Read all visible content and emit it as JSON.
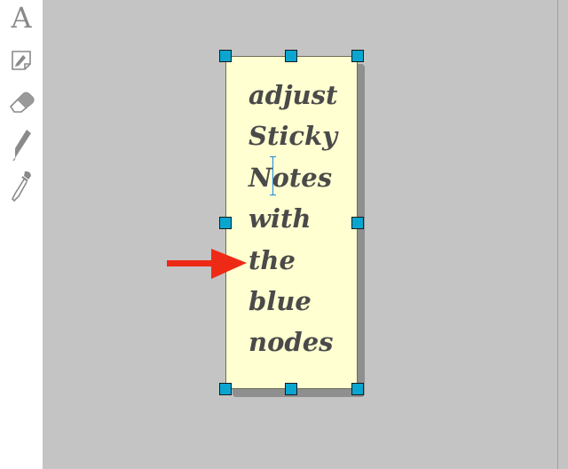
{
  "toolbar": {
    "tools": [
      {
        "name": "text-tool",
        "icon": "text-a-icon",
        "glyph": "A"
      },
      {
        "name": "sticky-note-tool",
        "icon": "sticky-note-icon"
      },
      {
        "name": "eraser-tool",
        "icon": "eraser-icon"
      },
      {
        "name": "pen-tool",
        "icon": "pen-icon"
      },
      {
        "name": "eyedropper-tool",
        "icon": "eyedropper-icon"
      }
    ]
  },
  "sticky_note": {
    "lines": [
      "adjust",
      "Sticky",
      "Notes",
      "with",
      "the",
      "blue",
      "nodes"
    ],
    "background_color": "#ffffd1",
    "text_color": "#4a4a4a",
    "handle_color": "#0aa6d0"
  },
  "annotation": {
    "arrow_color": "#ee2a16"
  }
}
